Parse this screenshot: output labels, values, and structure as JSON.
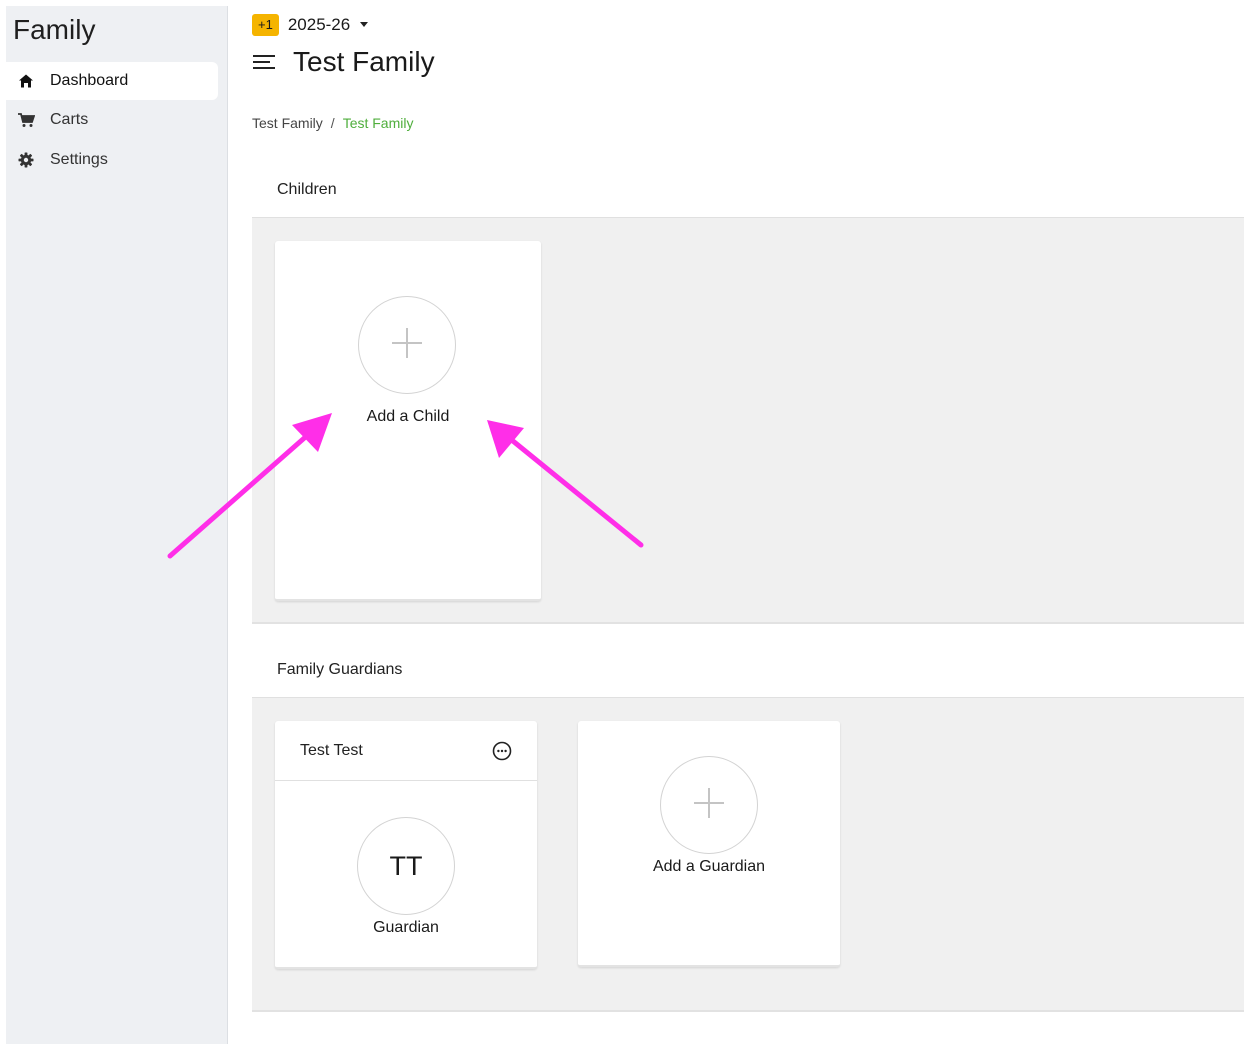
{
  "sidebar": {
    "app_title": "Family",
    "items": [
      {
        "label": "Dashboard",
        "icon": "home-icon",
        "active": true
      },
      {
        "label": "Carts",
        "icon": "cart-icon",
        "active": false
      },
      {
        "label": "Settings",
        "icon": "gear-icon",
        "active": false
      }
    ]
  },
  "header": {
    "badge": "+1",
    "year": "2025-26",
    "title": "Test Family"
  },
  "breadcrumb": {
    "items": [
      "Test Family",
      "Test Family"
    ],
    "separator": "/"
  },
  "children_section": {
    "title": "Children",
    "add_label": "Add a Child"
  },
  "guardians_section": {
    "title": "Family Guardians",
    "guardians": [
      {
        "name": "Test Test",
        "initials": "TT",
        "role": "Guardian"
      }
    ],
    "add_label": "Add a Guardian"
  },
  "colors": {
    "accent_green": "#4fae3c",
    "badge_yellow": "#f5b400",
    "annotation_magenta": "#ff2ee8"
  }
}
